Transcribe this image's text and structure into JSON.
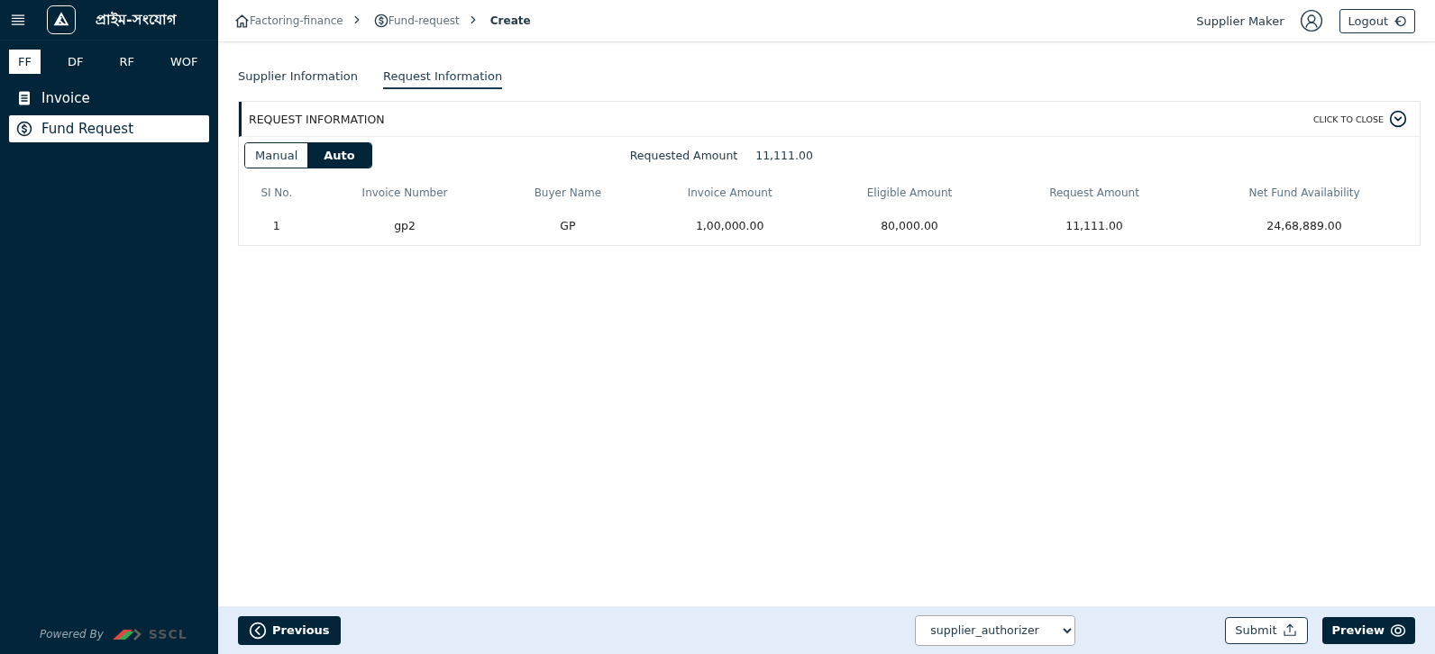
{
  "sidebar": {
    "brand": "প্রাইম-সংযোগ",
    "modules": [
      {
        "label": "FF",
        "selected": true
      },
      {
        "label": "DF",
        "selected": false
      },
      {
        "label": "RF",
        "selected": false
      },
      {
        "label": "WOF",
        "selected": false
      }
    ],
    "items": [
      {
        "label": "Invoice",
        "kind": "invoice",
        "selected": false
      },
      {
        "label": "Fund Request",
        "kind": "fund",
        "selected": true
      }
    ],
    "powered_by": "Powered By",
    "vendor": "SSCL"
  },
  "breadcrumb": [
    {
      "label": "Factoring-finance",
      "kind": "home"
    },
    {
      "label": "Fund-request",
      "kind": "fund"
    },
    {
      "label": "Create",
      "kind": "current"
    }
  ],
  "user": {
    "name": "Supplier Maker",
    "logout": "Logout"
  },
  "tabs": [
    {
      "label": "Supplier Information",
      "selected": false
    },
    {
      "label": "Request Information",
      "selected": true
    }
  ],
  "panel": {
    "title": "REQUEST INFORMATION",
    "close": "CLICK TO CLOSE",
    "mode": [
      {
        "label": "Manual",
        "selected": false
      },
      {
        "label": "Auto",
        "selected": true
      }
    ],
    "requested_label": "Requested Amount",
    "requested_value": "11,111.00",
    "table": {
      "columns": [
        "SI No.",
        "Invoice Number",
        "Buyer Name",
        "Invoice Amount",
        "Eligible Amount",
        "Request Amount",
        "Net Fund Availability"
      ],
      "rows": [
        [
          "1",
          "gp2",
          "GP",
          "1,00,000.00",
          "80,000.00",
          "11,111.00",
          "24,68,889.00"
        ]
      ]
    }
  },
  "footer": {
    "previous": "Previous",
    "role": "supplier_authorizer",
    "submit": "Submit",
    "preview": "Preview"
  }
}
